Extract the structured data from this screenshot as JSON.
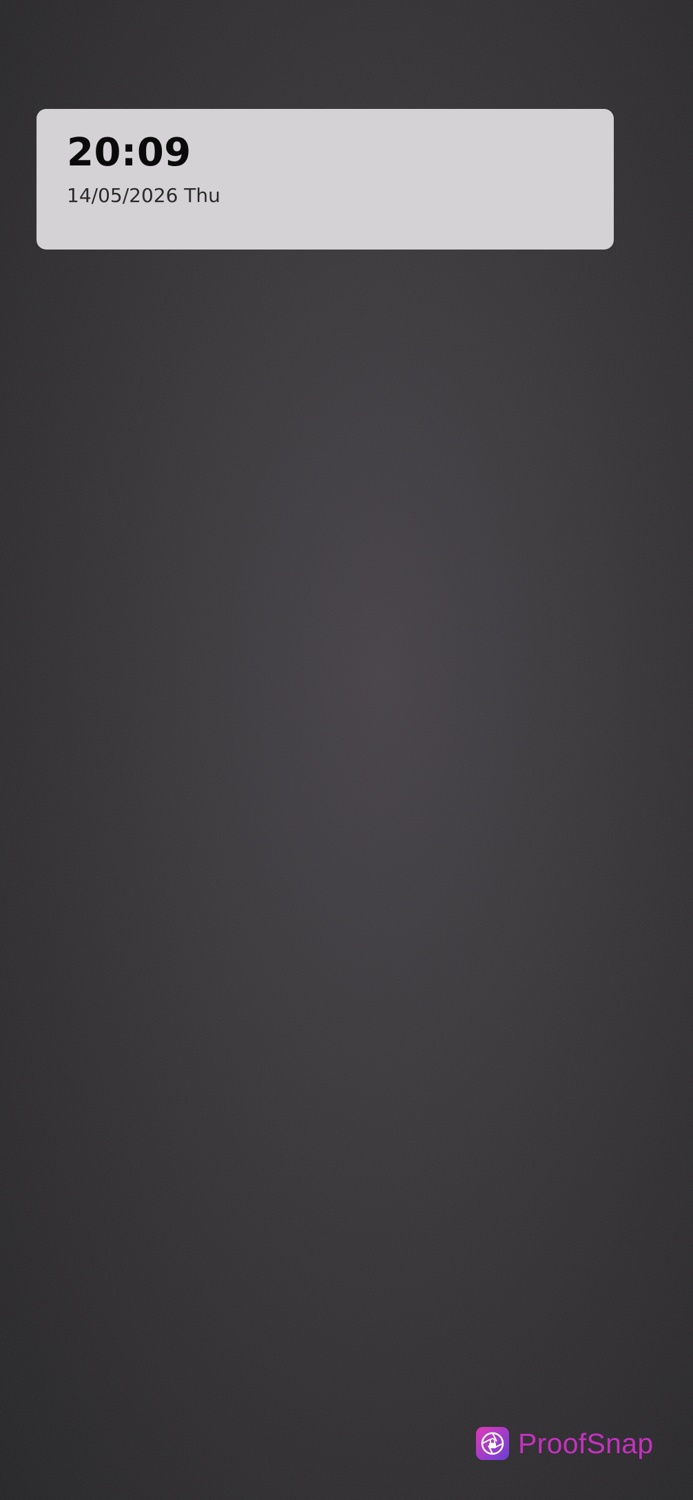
{
  "timestamp": {
    "time": "20:09",
    "date": "14/05/2026 Thu"
  },
  "watermark": {
    "brand": "ProofSnap",
    "icon": "camera-shutter-lock-icon",
    "brand_color": "#c531c0"
  }
}
